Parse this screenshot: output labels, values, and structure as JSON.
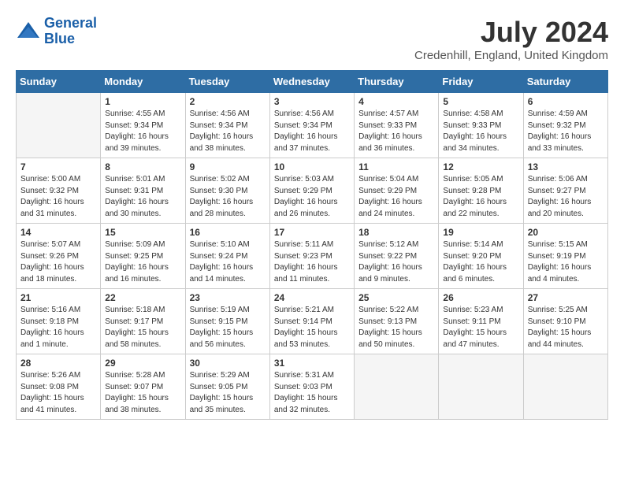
{
  "header": {
    "logo_line1": "General",
    "logo_line2": "Blue",
    "month_year": "July 2024",
    "location": "Credenhill, England, United Kingdom"
  },
  "weekdays": [
    "Sunday",
    "Monday",
    "Tuesday",
    "Wednesday",
    "Thursday",
    "Friday",
    "Saturday"
  ],
  "weeks": [
    [
      {
        "day": "",
        "text": ""
      },
      {
        "day": "1",
        "text": "Sunrise: 4:55 AM\nSunset: 9:34 PM\nDaylight: 16 hours\nand 39 minutes."
      },
      {
        "day": "2",
        "text": "Sunrise: 4:56 AM\nSunset: 9:34 PM\nDaylight: 16 hours\nand 38 minutes."
      },
      {
        "day": "3",
        "text": "Sunrise: 4:56 AM\nSunset: 9:34 PM\nDaylight: 16 hours\nand 37 minutes."
      },
      {
        "day": "4",
        "text": "Sunrise: 4:57 AM\nSunset: 9:33 PM\nDaylight: 16 hours\nand 36 minutes."
      },
      {
        "day": "5",
        "text": "Sunrise: 4:58 AM\nSunset: 9:33 PM\nDaylight: 16 hours\nand 34 minutes."
      },
      {
        "day": "6",
        "text": "Sunrise: 4:59 AM\nSunset: 9:32 PM\nDaylight: 16 hours\nand 33 minutes."
      }
    ],
    [
      {
        "day": "7",
        "text": "Sunrise: 5:00 AM\nSunset: 9:32 PM\nDaylight: 16 hours\nand 31 minutes."
      },
      {
        "day": "8",
        "text": "Sunrise: 5:01 AM\nSunset: 9:31 PM\nDaylight: 16 hours\nand 30 minutes."
      },
      {
        "day": "9",
        "text": "Sunrise: 5:02 AM\nSunset: 9:30 PM\nDaylight: 16 hours\nand 28 minutes."
      },
      {
        "day": "10",
        "text": "Sunrise: 5:03 AM\nSunset: 9:29 PM\nDaylight: 16 hours\nand 26 minutes."
      },
      {
        "day": "11",
        "text": "Sunrise: 5:04 AM\nSunset: 9:29 PM\nDaylight: 16 hours\nand 24 minutes."
      },
      {
        "day": "12",
        "text": "Sunrise: 5:05 AM\nSunset: 9:28 PM\nDaylight: 16 hours\nand 22 minutes."
      },
      {
        "day": "13",
        "text": "Sunrise: 5:06 AM\nSunset: 9:27 PM\nDaylight: 16 hours\nand 20 minutes."
      }
    ],
    [
      {
        "day": "14",
        "text": "Sunrise: 5:07 AM\nSunset: 9:26 PM\nDaylight: 16 hours\nand 18 minutes."
      },
      {
        "day": "15",
        "text": "Sunrise: 5:09 AM\nSunset: 9:25 PM\nDaylight: 16 hours\nand 16 minutes."
      },
      {
        "day": "16",
        "text": "Sunrise: 5:10 AM\nSunset: 9:24 PM\nDaylight: 16 hours\nand 14 minutes."
      },
      {
        "day": "17",
        "text": "Sunrise: 5:11 AM\nSunset: 9:23 PM\nDaylight: 16 hours\nand 11 minutes."
      },
      {
        "day": "18",
        "text": "Sunrise: 5:12 AM\nSunset: 9:22 PM\nDaylight: 16 hours\nand 9 minutes."
      },
      {
        "day": "19",
        "text": "Sunrise: 5:14 AM\nSunset: 9:20 PM\nDaylight: 16 hours\nand 6 minutes."
      },
      {
        "day": "20",
        "text": "Sunrise: 5:15 AM\nSunset: 9:19 PM\nDaylight: 16 hours\nand 4 minutes."
      }
    ],
    [
      {
        "day": "21",
        "text": "Sunrise: 5:16 AM\nSunset: 9:18 PM\nDaylight: 16 hours\nand 1 minute."
      },
      {
        "day": "22",
        "text": "Sunrise: 5:18 AM\nSunset: 9:17 PM\nDaylight: 15 hours\nand 58 minutes."
      },
      {
        "day": "23",
        "text": "Sunrise: 5:19 AM\nSunset: 9:15 PM\nDaylight: 15 hours\nand 56 minutes."
      },
      {
        "day": "24",
        "text": "Sunrise: 5:21 AM\nSunset: 9:14 PM\nDaylight: 15 hours\nand 53 minutes."
      },
      {
        "day": "25",
        "text": "Sunrise: 5:22 AM\nSunset: 9:13 PM\nDaylight: 15 hours\nand 50 minutes."
      },
      {
        "day": "26",
        "text": "Sunrise: 5:23 AM\nSunset: 9:11 PM\nDaylight: 15 hours\nand 47 minutes."
      },
      {
        "day": "27",
        "text": "Sunrise: 5:25 AM\nSunset: 9:10 PM\nDaylight: 15 hours\nand 44 minutes."
      }
    ],
    [
      {
        "day": "28",
        "text": "Sunrise: 5:26 AM\nSunset: 9:08 PM\nDaylight: 15 hours\nand 41 minutes."
      },
      {
        "day": "29",
        "text": "Sunrise: 5:28 AM\nSunset: 9:07 PM\nDaylight: 15 hours\nand 38 minutes."
      },
      {
        "day": "30",
        "text": "Sunrise: 5:29 AM\nSunset: 9:05 PM\nDaylight: 15 hours\nand 35 minutes."
      },
      {
        "day": "31",
        "text": "Sunrise: 5:31 AM\nSunset: 9:03 PM\nDaylight: 15 hours\nand 32 minutes."
      },
      {
        "day": "",
        "text": ""
      },
      {
        "day": "",
        "text": ""
      },
      {
        "day": "",
        "text": ""
      }
    ]
  ]
}
